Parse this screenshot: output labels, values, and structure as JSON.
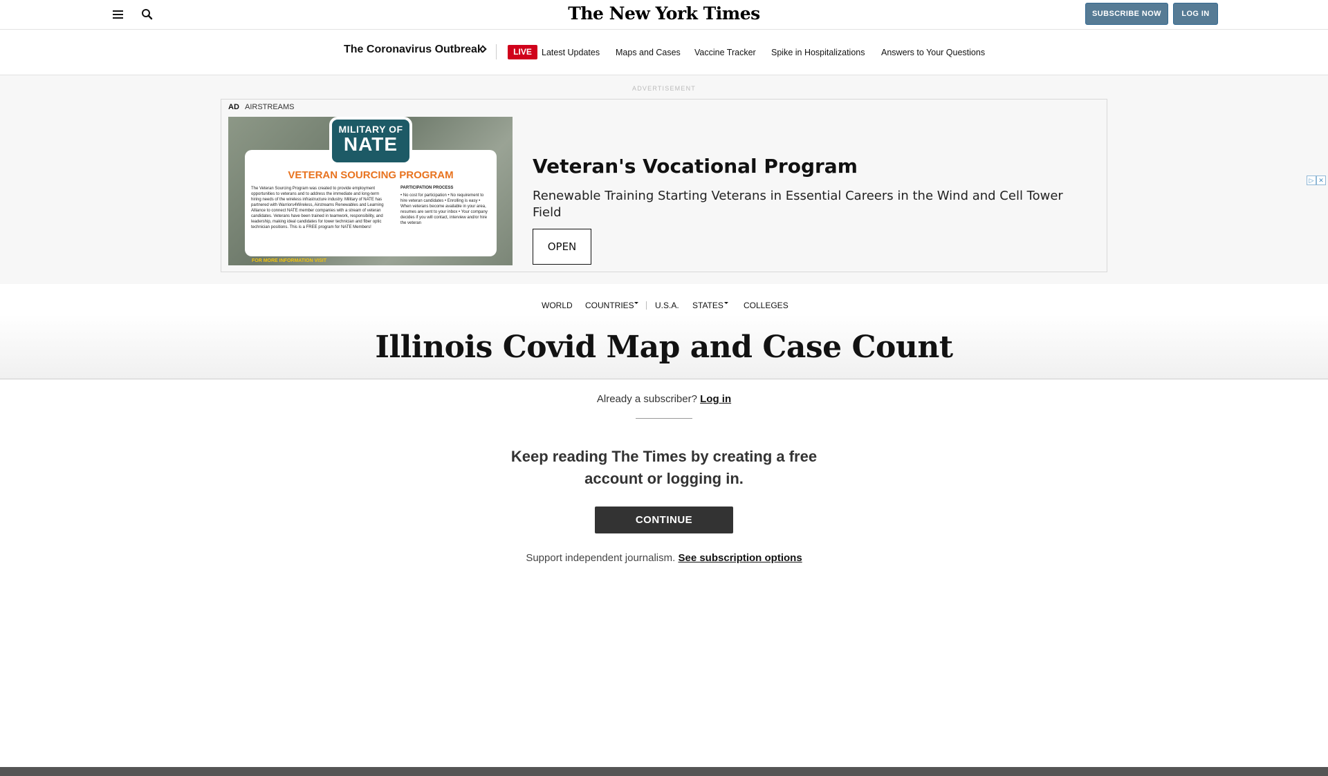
{
  "masthead": {
    "logo": "The New York Times",
    "subscribe_label": "SUBSCRIBE NOW",
    "login_label": "LOG IN"
  },
  "covid_bar": {
    "title": "The Coronavirus Outbreak",
    "live_label": "LIVE",
    "links": [
      "Latest Updates",
      "Maps and Cases",
      "Vaccine Tracker",
      "Spike in Hospitalizations",
      "Answers to Your Questions"
    ]
  },
  "ad": {
    "label": "ADVERTISEMENT",
    "tag": "AD",
    "sponsor": "AIRSTREAMS",
    "image": {
      "badge_top": "MILITARY OF",
      "badge_main": "NATE",
      "heading": "VETERAN SOURCING PROGRAM",
      "col_left": "The Veteran Sourcing Program was created to provide employment opportunities to veterans and to address the immediate and long-term hiring needs of the wireless infrastructure industry. Military of NATE has partnered with Warriors4Wireless, Airstreams Renewables and Learning Alliance to connect NATE member companies with a stream of veteran candidates. Veterans have been trained in teamwork, responsibility, and leadership, making ideal candidates for tower technician and fiber optic technician positions. This is a FREE program for NATE Members!",
      "col_right_title": "PARTICIPATION PROCESS",
      "col_right": "• No cost for participation • No requirement to hire veteran candidates • Enrolling is easy • When veterans become available in your area, resumes are sent to your inbox • Your company decides if you will contact, interview and/or hire the veteran",
      "footer": "FOR MORE INFORMATION VISIT"
    },
    "heading": "Veteran's Vocational Program",
    "description": "Renewable Training Starting Veterans in Essential Careers in the Wind and Cell Tower Field",
    "open_label": "OPEN"
  },
  "nav": {
    "world": "WORLD",
    "countries": "COUNTRIES",
    "usa": "U.S.A.",
    "states": "STATES",
    "colleges": "COLLEGES"
  },
  "page": {
    "title": "Illinois Covid Map and Case Count"
  },
  "regwall": {
    "subscriber_text": "Already a subscriber?",
    "login_link": "Log in",
    "heading": "Keep reading The Times by creating a free account or logging in.",
    "continue_label": "CONTINUE",
    "support_text": "Support independent journalism.",
    "subscription_link": "See subscription options"
  },
  "colors": {
    "live_red": "#d0021b",
    "subscribe_blue": "#567b95",
    "continue_dark": "#333333"
  }
}
